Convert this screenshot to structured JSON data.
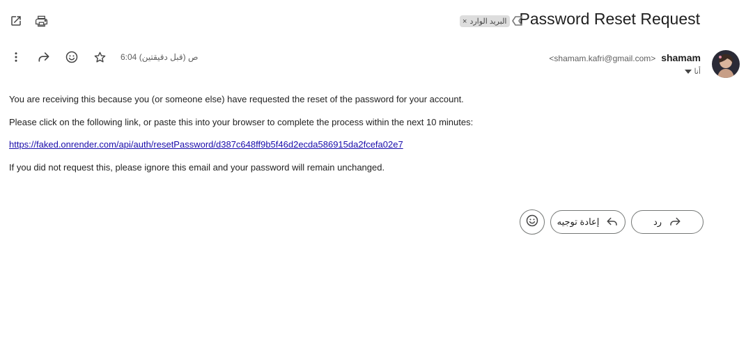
{
  "header": {
    "subject": "Password Reset Request",
    "label_chip": "البريد الوارد",
    "label_remove": "×"
  },
  "toolbar_top": {
    "open_new_window_icon": "open-in-new-icon",
    "print_icon": "print-icon"
  },
  "message": {
    "sender_name": "shamam",
    "sender_email": "<shamam.kafri@gmail.com>",
    "to": "أنا",
    "time": "6:04 ص (قبل دقيقتين)",
    "actions": [
      "more-icon",
      "forward-icon",
      "emoji-icon",
      "star-icon"
    ]
  },
  "body": {
    "line1": "You are receiving this because you (or someone else) have requested the reset of the password for your account.",
    "line2": "Please click on the following link, or paste this into your browser to complete the process within the next 10 minutes:",
    "link": "https://faked.onrender.com/api/auth/resetPassword/d387c648ff9b5f46d2ecda586915da2fcefa02e7",
    "line3": "If you did not request this, please ignore this email and your password will remain unchanged."
  },
  "footer": {
    "reply_label": "رد",
    "forward_label": "إعادة توجيه"
  },
  "colors": {
    "link": "#1a0dab",
    "chip_bg": "#dddddd",
    "border": "#747775"
  }
}
